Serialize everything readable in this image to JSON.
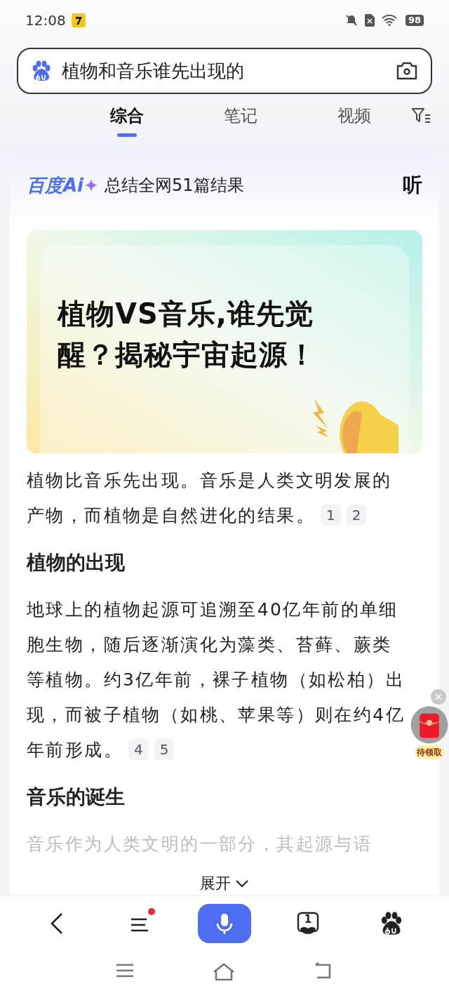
{
  "status_bar": {
    "time": "12:08",
    "battery": "98"
  },
  "search": {
    "value": "植物和音乐谁先出现的"
  },
  "tabs": [
    {
      "label": "综合",
      "selected": true
    },
    {
      "label": "笔记",
      "selected": false
    },
    {
      "label": "视频",
      "selected": false
    }
  ],
  "ai_card": {
    "brand": "百度Ai",
    "summary": "总结全网51篇结果",
    "listen": "听",
    "cover": {
      "title": "植物VS音乐,谁先觉醒？揭秘宇宙起源！"
    },
    "blocks": [
      {
        "kind": "paragraph",
        "text": "植物比音乐先出现。音乐是人类文明发展的产物，而植物是自然进化的结果。",
        "citations": [
          "1",
          "2"
        ]
      },
      {
        "kind": "heading",
        "text": "植物的出现"
      },
      {
        "kind": "paragraph",
        "text": "地球上的植物起源可追溯至40亿年前的单细胞生物，随后逐渐演化为藻类、苔藓、蕨类等植物。约3亿年前，裸子植物（如松柏）出现，而被子植物（如桃、苹果等）则在约4亿年前形成。",
        "citations": [
          "4",
          "5"
        ]
      },
      {
        "kind": "heading",
        "text": "音乐的诞生"
      },
      {
        "kind": "faded",
        "text": "音乐作为人类文明的一部分，其起源与语"
      }
    ],
    "expand": "展开"
  },
  "floating_badge": {
    "label": "待领取"
  },
  "bottom_nav": [
    {
      "kind": "back",
      "dot": false
    },
    {
      "kind": "menu",
      "dot": true
    },
    {
      "kind": "voice",
      "dot": false
    },
    {
      "kind": "tabs",
      "count": "1",
      "dot": false
    },
    {
      "kind": "home",
      "dot": false
    }
  ]
}
